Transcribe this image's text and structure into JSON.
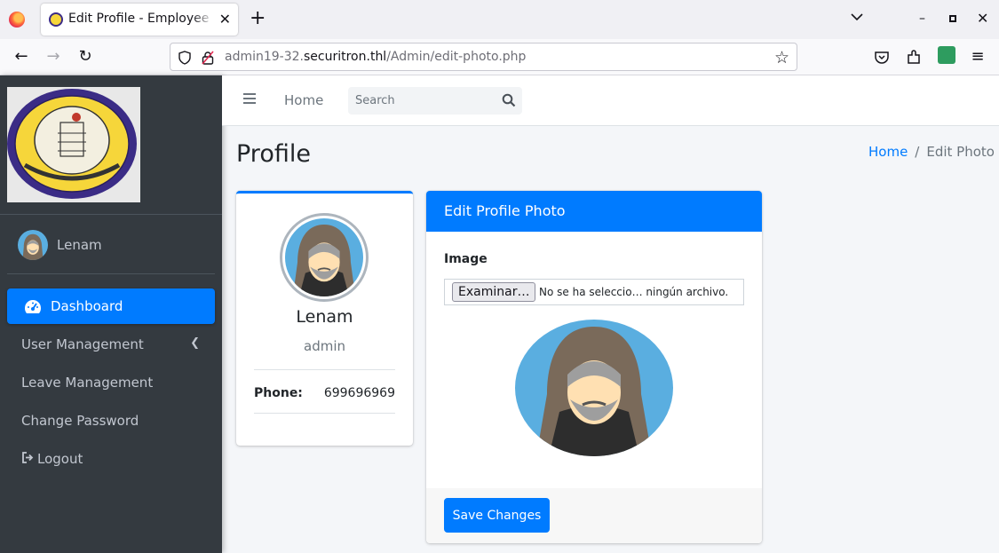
{
  "browser": {
    "tab_title": "Edit Profile - Employee Management",
    "url_prefix": "admin19-32.",
    "url_domain": "securitron.thl",
    "url_path": "/Admin/edit-photo.php"
  },
  "sidebar": {
    "user_name": "Lenam",
    "items": [
      {
        "label": "Dashboard",
        "icon": "tachometer-icon",
        "active": true
      },
      {
        "label": "User Management",
        "icon": "chevron-left-icon"
      },
      {
        "label": "Leave Management"
      },
      {
        "label": "Change Password"
      },
      {
        "label": "Logout",
        "icon": "sign-out-icon"
      }
    ]
  },
  "topnav": {
    "home": "Home",
    "search_placeholder": "Search"
  },
  "page": {
    "title": "Profile",
    "breadcrumb_home": "Home",
    "breadcrumb_sep": "/",
    "breadcrumb_current": "Edit Photo"
  },
  "profile": {
    "name": "Lenam",
    "role": "admin",
    "phone_label": "Phone:",
    "phone_value": "699696969"
  },
  "edit_card": {
    "title": "Edit Profile Photo",
    "image_label": "Image",
    "file_button": "Examinar…",
    "file_status": "No se ha seleccio… ningún archivo.",
    "save_button": "Save Changes"
  },
  "colors": {
    "primary": "#007bff",
    "sidebar_bg": "#343a40",
    "avatar_bg": "#5aaee0"
  }
}
